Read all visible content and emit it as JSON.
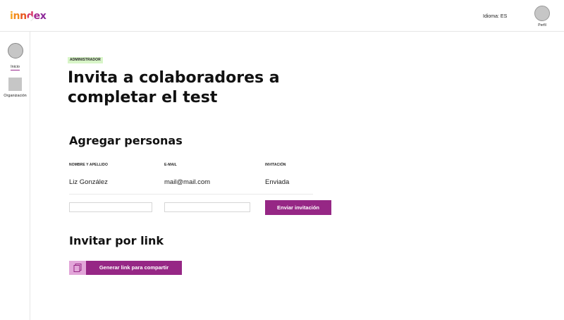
{
  "app": {
    "logo_letters": [
      "i",
      "n",
      "n",
      "d",
      "e",
      "x"
    ]
  },
  "header": {
    "language_label": "Idioma: ES",
    "profile_label": "Perfil"
  },
  "sidebar": {
    "items": [
      {
        "label": "Inicio",
        "active": true
      },
      {
        "label": "Organización",
        "active": false
      }
    ]
  },
  "main": {
    "badge": "ADMINISTRADOR",
    "title": "Invita a colaboradores a completar el test",
    "add_section": {
      "title": "Agregar personas",
      "columns": [
        "NOMBRE Y APELLIDO",
        "E-MAIL",
        "INVITACIÓN"
      ],
      "rows": [
        {
          "name": "Liz González",
          "email": "mail@mail.com",
          "status": "Enviada"
        }
      ],
      "name_input": {
        "value": "",
        "placeholder": ""
      },
      "email_input": {
        "value": "",
        "placeholder": ""
      },
      "send_button": "Enviar invitación"
    },
    "link_section": {
      "title": "Invitar por link",
      "generate_button": "Generar link para compartir",
      "button_icon": "copy-icon"
    }
  },
  "colors": {
    "accent": "#962785",
    "accent_light": "#e2a6d9",
    "badge_bg": "#d8f5c8"
  }
}
